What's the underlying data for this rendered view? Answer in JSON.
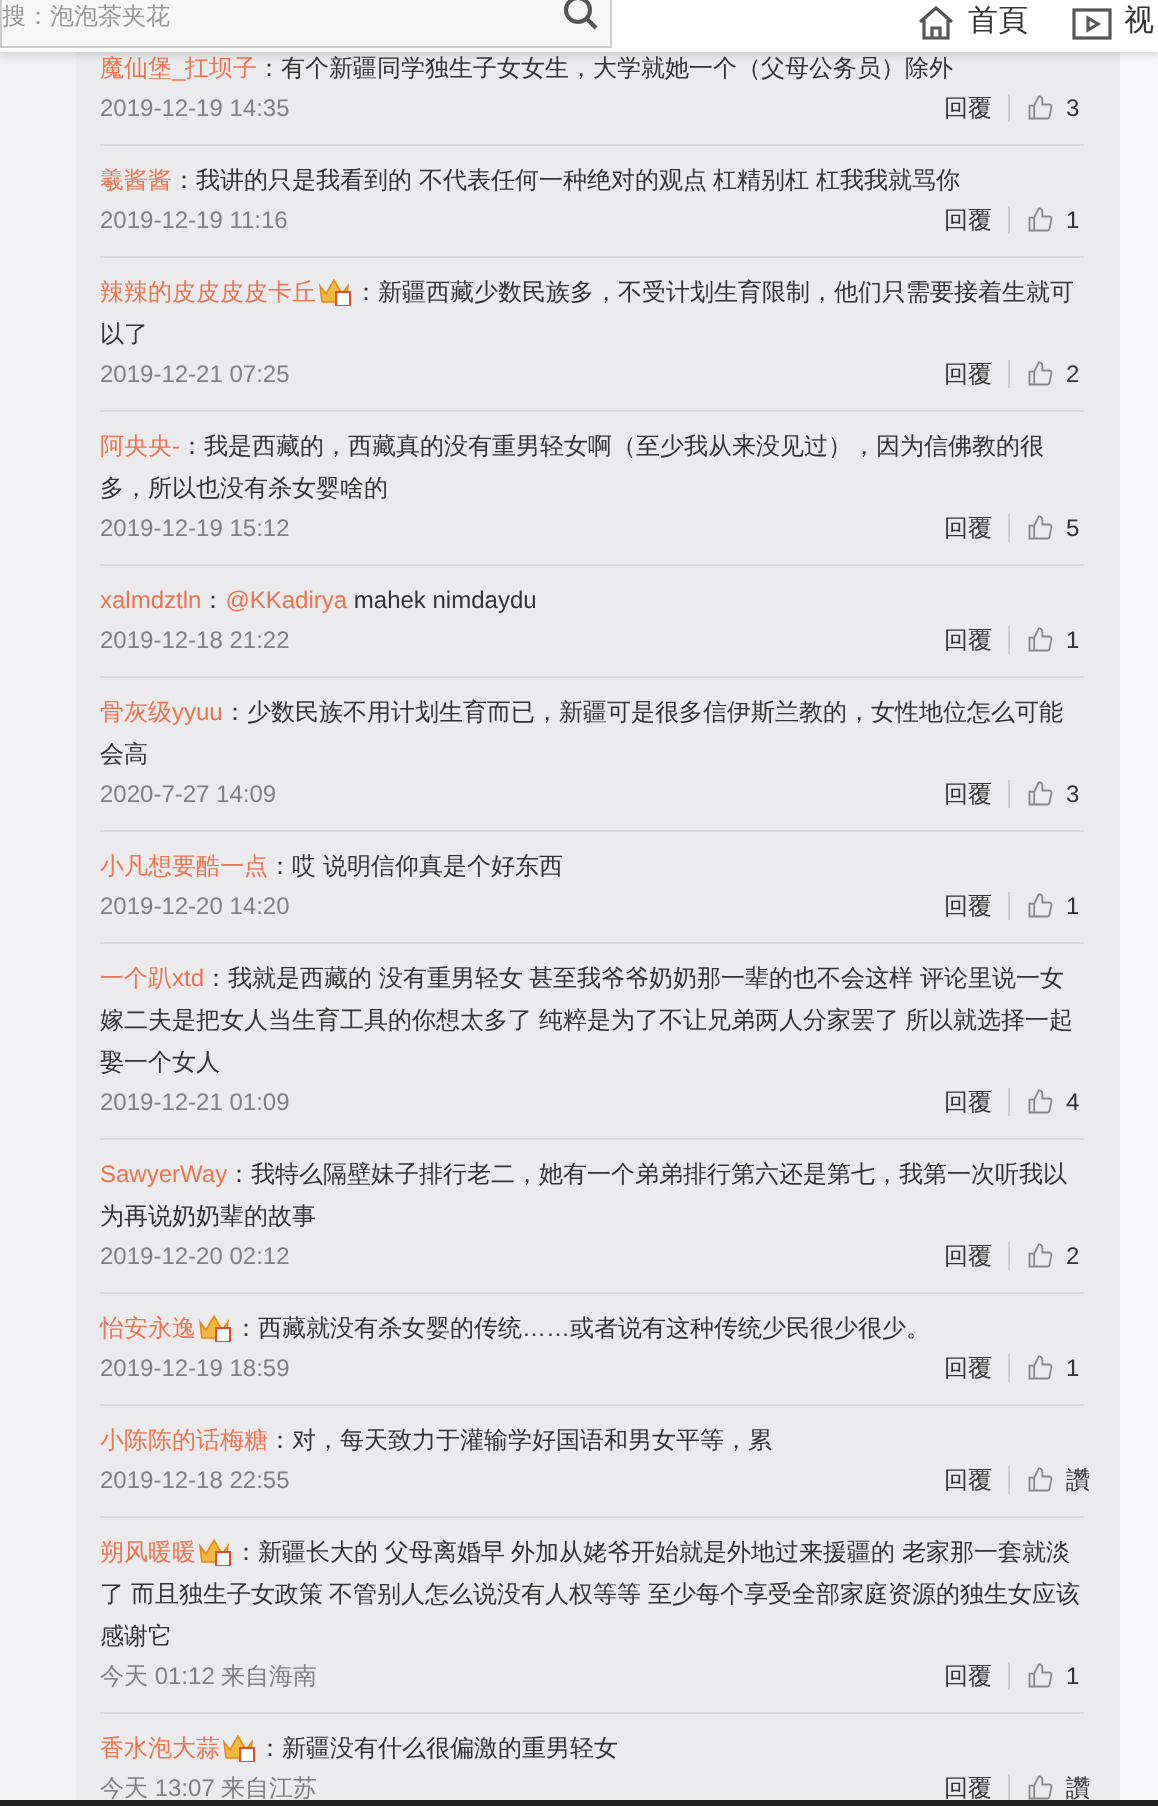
{
  "search": {
    "placeholder": "搜：泡泡茶夹花"
  },
  "nav": [
    {
      "label": "首頁",
      "kind": "home"
    },
    {
      "label": "视",
      "kind": "video"
    }
  ],
  "comments": [
    {
      "user": "魔仙堡_扛坝子",
      "badge": false,
      "sep": "：",
      "text": "有个新疆同学独生子女女生，大学就她一个（父母公务员）除外",
      "time": "2019-12-19 14:35",
      "reply": "回覆",
      "likes": "3"
    },
    {
      "user": "羲酱酱",
      "badge": false,
      "sep": "：",
      "text": "我讲的只是我看到的 不代表任何一种绝对的观点 杠精别杠 杠我我就骂你",
      "time": "2019-12-19 11:16",
      "reply": "回覆",
      "likes": "1"
    },
    {
      "user": "辣辣的皮皮皮皮卡丘",
      "badge": true,
      "sep": "：",
      "text": "新疆西藏少数民族多，不受计划生育限制，他们只需要接着生就可以了",
      "time": "2019-12-21 07:25",
      "reply": "回覆",
      "likes": "2"
    },
    {
      "user": "阿央央-",
      "badge": false,
      "sep": "：",
      "text": "我是西藏的，西藏真的没有重男轻女啊（至少我从来没见过），因为信佛教的很多，所以也没有杀女婴啥的",
      "time": "2019-12-19 15:12",
      "reply": "回覆",
      "likes": "5"
    },
    {
      "user": "xalmdztln",
      "badge": false,
      "sep": "：",
      "mention": "@KKadirya",
      "text": "mahek nimdaydu",
      "time": "2019-12-18 21:22",
      "reply": "回覆",
      "likes": "1"
    },
    {
      "user": "骨灰级yyuu",
      "badge": false,
      "sep": "：",
      "text": "少数民族不用计划生育而已，新疆可是很多信伊斯兰教的，女性地位怎么可能会高",
      "time": "2020-7-27 14:09",
      "reply": "回覆",
      "likes": "3"
    },
    {
      "user": "小凡想要酷一点",
      "badge": false,
      "sep": "：",
      "text": "哎 说明信仰真是个好东西",
      "time": "2019-12-20 14:20",
      "reply": "回覆",
      "likes": "1"
    },
    {
      "user": "一个趴xtd",
      "badge": false,
      "sep": "：",
      "text": "我就是西藏的 没有重男轻女 甚至我爷爷奶奶那一辈的也不会这样 评论里说一女嫁二夫是把女人当生育工具的你想太多了 纯粹是为了不让兄弟两人分家罢了 所以就选择一起娶一个女人",
      "time": "2019-12-21 01:09",
      "reply": "回覆",
      "likes": "4"
    },
    {
      "user": "SawyerWay",
      "badge": false,
      "sep": "：",
      "text": "我特么隔壁妹子排行老二，她有一个弟弟排行第六还是第七，我第一次听我以为再说奶奶辈的故事",
      "time": "2019-12-20 02:12",
      "reply": "回覆",
      "likes": "2"
    },
    {
      "user": "怡安永逸",
      "badge": true,
      "sep": "：",
      "text": "西藏就没有杀女婴的传统……或者说有这种传统少民很少很少。",
      "time": "2019-12-19 18:59",
      "reply": "回覆",
      "likes": "1"
    },
    {
      "user": "小陈陈的话梅糖",
      "badge": false,
      "sep": "：",
      "text": "对，每天致力于灌输学好国语和男女平等，累",
      "time": "2019-12-18 22:55",
      "reply": "回覆",
      "likes": "讚"
    },
    {
      "user": "朔风暖暖",
      "badge": true,
      "sep": "：",
      "text": "新疆长大的 父母离婚早 外加从姥爷开始就是外地过来援疆的 老家那一套就淡了 而且独生子女政策 不管别人怎么说没有人权等等 至少每个享受全部家庭资源的独生女应该感谢它",
      "time": "今天 01:12 来自海南",
      "reply": "回覆",
      "likes": "1"
    },
    {
      "user": "香水泡大蒜",
      "badge": true,
      "sep": "：",
      "text": "新疆没有什么很偏激的重男轻女",
      "time": "今天 13:07 来自江苏",
      "reply": "回覆",
      "likes": "讚"
    }
  ]
}
